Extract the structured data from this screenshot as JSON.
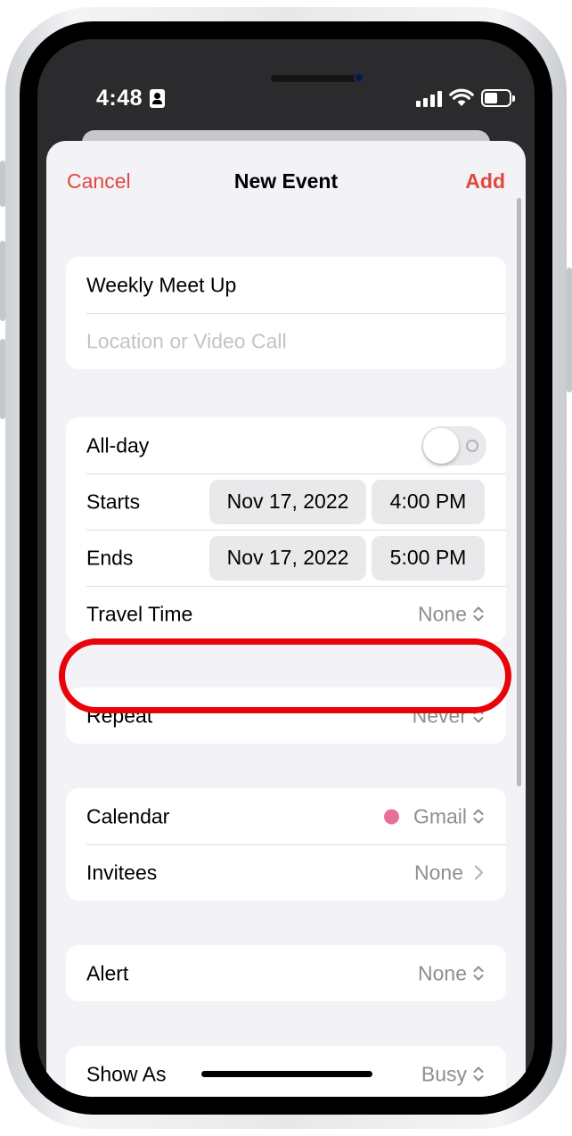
{
  "status_bar": {
    "time": "4:48"
  },
  "nav": {
    "cancel_label": "Cancel",
    "title": "New Event",
    "add_label": "Add"
  },
  "details": {
    "title_value": "Weekly Meet Up",
    "location_placeholder": "Location or Video Call"
  },
  "schedule": {
    "all_day_label": "All-day",
    "all_day_on": false,
    "starts_label": "Starts",
    "starts_date": "Nov 17, 2022",
    "starts_time": "4:00 PM",
    "ends_label": "Ends",
    "ends_date": "Nov 17, 2022",
    "ends_time": "5:00 PM",
    "travel_label": "Travel Time",
    "travel_value": "None"
  },
  "repeat": {
    "label": "Repeat",
    "value": "Never"
  },
  "calendar": {
    "label": "Calendar",
    "value": "Gmail",
    "dot_color": "#e8709a",
    "invitees_label": "Invitees",
    "invitees_value": "None"
  },
  "alert": {
    "label": "Alert",
    "value": "None"
  },
  "show_as": {
    "label": "Show As",
    "value": "Busy"
  },
  "colors": {
    "accent": "#e04a3f",
    "highlight": "#e8020a",
    "secondary_text": "#8e8e93"
  }
}
